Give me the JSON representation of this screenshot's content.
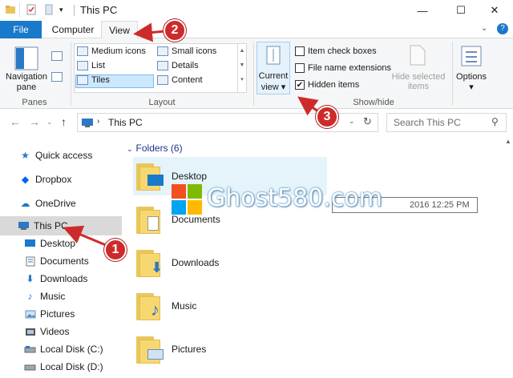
{
  "window": {
    "title": "This PC",
    "minimize": "—",
    "maximize": "☐",
    "close": "✕"
  },
  "tabs": {
    "file": "File",
    "computer": "Computer",
    "view": "View"
  },
  "ribbon": {
    "panes": {
      "navigation_pane_line1": "Navigation",
      "navigation_pane_line2": "pane",
      "group_label": "Panes"
    },
    "layout": {
      "items": [
        "Medium icons",
        "Small icons",
        "List",
        "Details",
        "Tiles",
        "Content"
      ],
      "group_label": "Layout"
    },
    "current_view": {
      "line1": "Current",
      "line2": "view"
    },
    "show_hide": {
      "item_check_boxes": "Item check boxes",
      "file_name_extensions": "File name extensions",
      "hidden_items": "Hidden items",
      "hidden_items_checked": true,
      "hide_selected_line1": "Hide selected",
      "hide_selected_line2": "items",
      "group_label": "Show/hide"
    },
    "options": "Options"
  },
  "address": {
    "path": "This PC",
    "search_placeholder": "Search This PC"
  },
  "nav": {
    "items": [
      {
        "label": "Quick access",
        "icon": "star-icon"
      },
      {
        "label": "Dropbox",
        "icon": "dropbox-icon"
      },
      {
        "label": "OneDrive",
        "icon": "cloud-icon"
      },
      {
        "label": "This PC",
        "icon": "monitor-icon"
      },
      {
        "label": "Desktop",
        "icon": "desktop-icon"
      },
      {
        "label": "Documents",
        "icon": "documents-icon"
      },
      {
        "label": "Downloads",
        "icon": "download-icon"
      },
      {
        "label": "Music",
        "icon": "music-icon"
      },
      {
        "label": "Pictures",
        "icon": "pictures-icon"
      },
      {
        "label": "Videos",
        "icon": "videos-icon"
      },
      {
        "label": "Local Disk (C:)",
        "icon": "disk-icon"
      },
      {
        "label": "Local Disk (D:)",
        "icon": "disk-icon"
      }
    ]
  },
  "content": {
    "group_header": "Folders (6)",
    "folders": [
      "Desktop",
      "Documents",
      "Downloads",
      "Music",
      "Pictures"
    ],
    "tooltip_date": "2016 12:25 PM"
  },
  "watermark": "Ghost580.com",
  "annotations": [
    "1",
    "2",
    "3"
  ],
  "colors": {
    "accent": "#1979ca",
    "annotation": "#cd2b2b",
    "selection": "#cce8ff"
  }
}
